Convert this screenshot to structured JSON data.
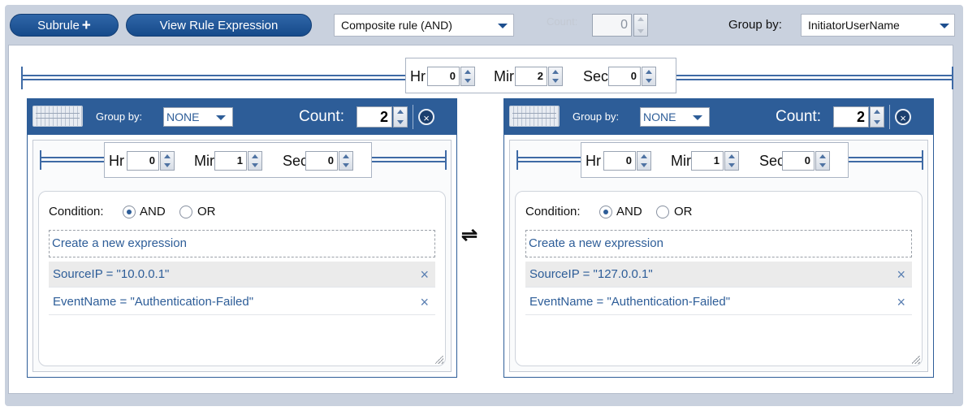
{
  "toolbar": {
    "subrule_label": "Subrule",
    "subrule_plus": "+",
    "view_expression_label": "View Rule Expression",
    "rule_type": "Composite rule (AND)",
    "count_label": "Count:",
    "count_value": "0",
    "group_by_label": "Group by:",
    "group_by_value": "InitiatorUserName"
  },
  "top_timer": {
    "hr_label": "Hr",
    "hr_value": "0",
    "min_label": "Mir",
    "min_value": "2",
    "sec_label": "Sec",
    "sec_value": "0"
  },
  "swap_symbol": "⇌",
  "subrules": [
    {
      "group_by_label": "Group by:",
      "group_by_value": "NONE",
      "count_label": "Count:",
      "count_value": "2",
      "close": "×",
      "timer": {
        "hr_label": "Hr",
        "hr_value": "0",
        "min_label": "Mir",
        "min_value": "1",
        "sec_label": "Sec",
        "sec_value": "0"
      },
      "condition_label": "Condition:",
      "and_label": "AND",
      "or_label": "OR",
      "new_expression": "Create a new expression",
      "expressions": [
        {
          "text": "SourceIP = \"10.0.0.1\"",
          "remove": "×"
        },
        {
          "text": "EventName = \"Authentication-Failed\"",
          "remove": "×"
        }
      ]
    },
    {
      "group_by_label": "Group by:",
      "group_by_value": "NONE",
      "count_label": "Count:",
      "count_value": "2",
      "close": "×",
      "timer": {
        "hr_label": "Hr",
        "hr_value": "0",
        "min_label": "Mir",
        "min_value": "1",
        "sec_label": "Sec",
        "sec_value": "0"
      },
      "condition_label": "Condition:",
      "and_label": "AND",
      "or_label": "OR",
      "new_expression": "Create a new expression",
      "expressions": [
        {
          "text": "SourceIP = \"127.0.0.1\"",
          "remove": "×"
        },
        {
          "text": "EventName = \"Authentication-Failed\"",
          "remove": "×"
        }
      ]
    }
  ]
}
